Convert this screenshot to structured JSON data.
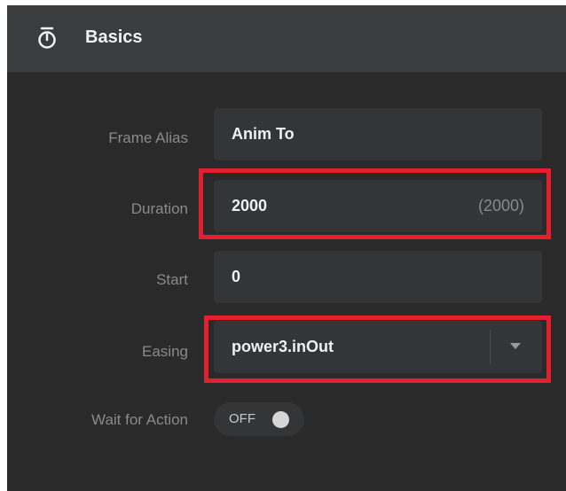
{
  "panel": {
    "title": "Basics",
    "icon": "stopwatch-icon"
  },
  "fields": {
    "frame_alias": {
      "label": "Frame Alias",
      "value": "Anim To"
    },
    "duration": {
      "label": "Duration",
      "value": "2000",
      "default_hint": "(2000)"
    },
    "start": {
      "label": "Start",
      "value": "0"
    },
    "easing": {
      "label": "Easing",
      "value": "power3.inOut"
    },
    "wait_for_action": {
      "label": "Wait for Action",
      "value": "OFF",
      "state": "off"
    }
  },
  "colors": {
    "highlight": "#e3202b",
    "panel_bg": "#2a2a2a",
    "header_bg": "#3b3c3e",
    "field_bg": "#343536"
  }
}
